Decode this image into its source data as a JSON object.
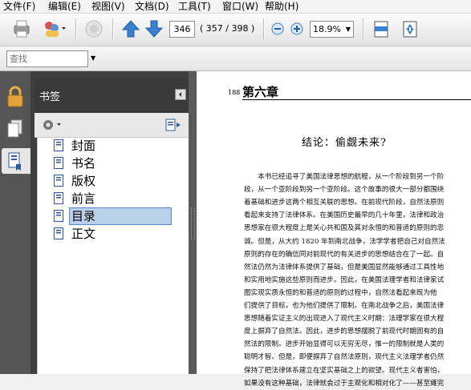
{
  "menu": [
    "文件(F)",
    "编辑(E)",
    "视图(V)",
    "文档(D)",
    "工具(T)",
    "窗口(W)",
    "帮助(H)"
  ],
  "toolbar": {
    "page_current": "346",
    "page_info": "( 357 / 398 )",
    "zoom": "18.9%"
  },
  "find": {
    "placeholder": "查找"
  },
  "bookmarks": {
    "title": "书签",
    "items": [
      {
        "label": "封面"
      },
      {
        "label": "书名"
      },
      {
        "label": "版权"
      },
      {
        "label": "前言"
      },
      {
        "label": "目录",
        "selected": true
      },
      {
        "label": "正文"
      }
    ]
  },
  "document": {
    "page_number": "188",
    "chapter": "第六章",
    "section_title": "结论：偷觑未来?",
    "lines": [
      "　　本书已经追寻了美国法律思想的航程，从一个阶段到另一个阶",
      "段，从一个亚阶段到另一个亚阶段。这个故事的很大一部分都围绕",
      "着基础和进步这两个相互关联的思想。在前现代阶段，自然法原则",
      "看起来支持了法律体系。在美国历史最早的几十年里，法律和政治",
      "思想家在很大程度上是关心共和国及其对永恒的和普适的原则的忠",
      "诚。但是，从大约 1820 年到南北战争，法学学者把自己对自然法",
      "原则的存在的确信同对前现代的有关进步的思想结合在了一起。自",
      "然法仍然为法律体系提供了基础，但是美国显然能够通过工具性地",
      "和实用地实施这些原则而进步。因此，在美国法理学者和法律家试",
      "图实现实质永恒的和普适的原则的过程中，自然法看起来既为他",
      "们提供了目标，也为他们提供了限制。在南北战争之后，美国法律",
      "思想随着实证主义的出现进入了现代主义时期：法理学家在很大程",
      "度上摒弃了自然法。因此，进步的思想摆脱了前现代时期固有的自",
      "然法的限制。进步开始显得可以无穷无尽，惟一的限制就是人类的",
      "聪明才智。但是，即便摒弃了自然法原则，现代主义法理学者仍然",
      "保持了把法律体系建立在坚实基础之上的欲望。现代主义者害怕，",
      "如果没有这种基础，法律就会过于主观化和相对化了——甚至瘫完"
    ]
  }
}
